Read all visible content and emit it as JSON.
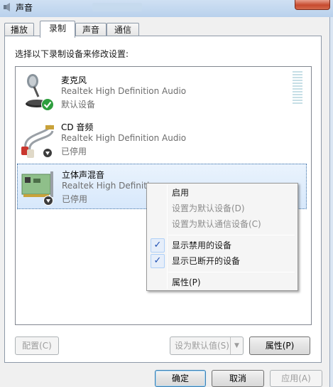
{
  "window": {
    "title": "声音"
  },
  "tabs": [
    {
      "label": "播放",
      "active": false
    },
    {
      "label": "录制",
      "active": true
    },
    {
      "label": "声音",
      "active": false
    },
    {
      "label": "通信",
      "active": false
    }
  ],
  "instruction": "选择以下录制设备来修改设置:",
  "devices": [
    {
      "name": "麦克风",
      "description": "Realtek High Definition Audio",
      "status": "默认设备",
      "icon": "microphone-icon",
      "badge": "default-check-icon",
      "selected": false
    },
    {
      "name": "CD 音频",
      "description": "Realtek High Definition Audio",
      "status": "已停用",
      "icon": "cd-audio-cable-icon",
      "badge": "disabled-arrow-icon",
      "selected": false
    },
    {
      "name": "立体声混音",
      "description": "Realtek High Definiti",
      "status": "已停用",
      "icon": "sound-card-icon",
      "badge": "disabled-arrow-icon",
      "selected": true
    }
  ],
  "context_menu": {
    "items": [
      {
        "label": "启用",
        "enabled": true,
        "checked": false
      },
      {
        "label": "设置为默认设备(D)",
        "enabled": false,
        "checked": false
      },
      {
        "label": "设置为默认通信设备(C)",
        "enabled": false,
        "checked": false
      },
      {
        "label": "显示禁用的设备",
        "enabled": true,
        "checked": true
      },
      {
        "label": "显示已断开的设备",
        "enabled": true,
        "checked": true
      },
      {
        "label": "属性(P)",
        "enabled": true,
        "checked": false
      }
    ],
    "check_glyph": "✓"
  },
  "panel_buttons": {
    "configure": "配置(C)",
    "set_default": "设为默认值(S)",
    "properties": "属性(P)"
  },
  "dialog_buttons": {
    "ok": "确定",
    "cancel": "取消",
    "apply": "应用(A)"
  },
  "colors": {
    "selection": "#d7e8fb",
    "check": "#1e4fb3",
    "default_badge": "#2e9e3e"
  }
}
